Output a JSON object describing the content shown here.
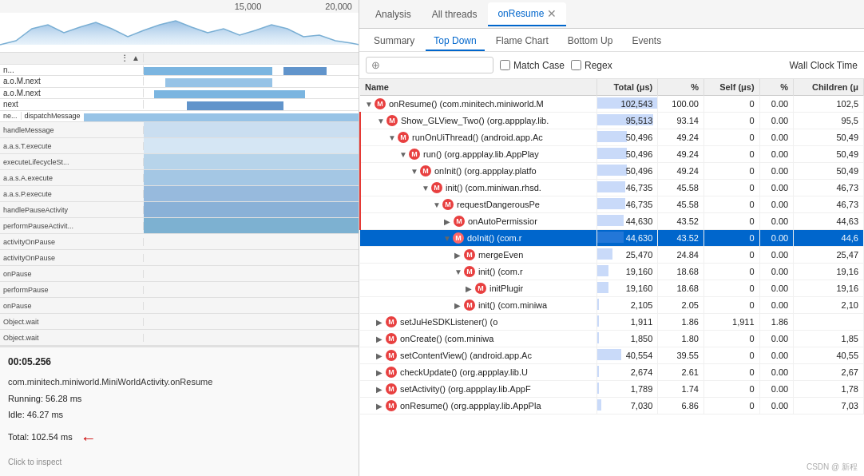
{
  "leftPanel": {
    "timelineNumbers": [
      "15,000",
      "20,000"
    ],
    "infoBox": {
      "time": "00:05.256",
      "className": "com.minitech.miniworld.MiniWorldActivity.onResume",
      "running": "Running: 56.28 ms",
      "idle": "Idle: 46.27 ms",
      "total": "Total: 102.54 ms",
      "clickHint": "Click to inspect"
    }
  },
  "rightPanel": {
    "tabs": [
      {
        "id": "analysis",
        "label": "Analysis",
        "active": false,
        "closeable": false
      },
      {
        "id": "allthreads",
        "label": "All threads",
        "active": false,
        "closeable": false
      },
      {
        "id": "onresume",
        "label": "onResume",
        "active": true,
        "closeable": true
      }
    ],
    "subtabs": [
      {
        "id": "summary",
        "label": "Summary",
        "active": false
      },
      {
        "id": "topdown",
        "label": "Top Down",
        "active": true
      },
      {
        "id": "flamechart",
        "label": "Flame Chart",
        "active": false
      },
      {
        "id": "bottomup",
        "label": "Bottom Up",
        "active": false
      },
      {
        "id": "events",
        "label": "Events",
        "active": false
      }
    ],
    "filter": {
      "searchPlaceholder": "⊕",
      "matchCaseLabel": "Match Case",
      "regexLabel": "Regex",
      "wallClockLabel": "Wall Clock Time"
    },
    "columns": [
      {
        "id": "name",
        "label": "Name"
      },
      {
        "id": "total",
        "label": "Total (μs)",
        "align": "right"
      },
      {
        "id": "pct",
        "label": "%",
        "align": "right"
      },
      {
        "id": "self",
        "label": "Self (μs)",
        "align": "right"
      },
      {
        "id": "selfpct",
        "label": "%",
        "align": "right"
      },
      {
        "id": "children",
        "label": "Children (μ",
        "align": "right"
      }
    ],
    "rows": [
      {
        "id": 1,
        "indent": 0,
        "expanded": true,
        "arrow": "▼",
        "icon": "m",
        "name": "onResume() (com.minitech.miniworld.M",
        "total": "102,543",
        "pct": "100.00",
        "self": "0",
        "selfpct": "0.00",
        "children": "102,5",
        "selected": false,
        "redbox": false
      },
      {
        "id": 2,
        "indent": 1,
        "expanded": true,
        "arrow": "▼",
        "icon": "m",
        "name": "Show_GLView_Two() (org.appplay.lib.",
        "total": "95,513",
        "pct": "93.14",
        "self": "0",
        "selfpct": "0.00",
        "children": "95,5",
        "selected": false,
        "redbox": true
      },
      {
        "id": 3,
        "indent": 2,
        "expanded": true,
        "arrow": "▼",
        "icon": "m",
        "name": "runOnUiThread() (android.app.Ac",
        "total": "50,496",
        "pct": "49.24",
        "self": "0",
        "selfpct": "0.00",
        "children": "50,49",
        "selected": false,
        "redbox": true
      },
      {
        "id": 4,
        "indent": 3,
        "expanded": true,
        "arrow": "▼",
        "icon": "m",
        "name": "run() (org.appplay.lib.AppPlay",
        "total": "50,496",
        "pct": "49.24",
        "self": "0",
        "selfpct": "0.00",
        "children": "50,49",
        "selected": false,
        "redbox": true
      },
      {
        "id": 5,
        "indent": 4,
        "expanded": true,
        "arrow": "▼",
        "icon": "m",
        "name": "onInit() (org.appplay.platfo",
        "total": "50,496",
        "pct": "49.24",
        "self": "0",
        "selfpct": "0.00",
        "children": "50,49",
        "selected": false,
        "redbox": true
      },
      {
        "id": 6,
        "indent": 5,
        "expanded": true,
        "arrow": "▼",
        "icon": "m",
        "name": "init() (com.miniwan.rhsd.",
        "total": "46,735",
        "pct": "45.58",
        "self": "0",
        "selfpct": "0.00",
        "children": "46,73",
        "selected": false,
        "redbox": true
      },
      {
        "id": 7,
        "indent": 6,
        "expanded": true,
        "arrow": "▼",
        "icon": "m",
        "name": "requestDangerousPe",
        "total": "46,735",
        "pct": "45.58",
        "self": "0",
        "selfpct": "0.00",
        "children": "46,73",
        "selected": false,
        "redbox": true
      },
      {
        "id": 8,
        "indent": 7,
        "expanded": false,
        "arrow": "▶",
        "icon": "m",
        "name": "onAutoPermissior",
        "total": "44,630",
        "pct": "43.52",
        "self": "0",
        "selfpct": "0.00",
        "children": "44,63",
        "selected": false,
        "redbox": true
      },
      {
        "id": 9,
        "indent": 7,
        "expanded": true,
        "arrow": "▼",
        "icon": "m",
        "name": "doInit() (com.r",
        "total": "44,630",
        "pct": "43.52",
        "self": "0",
        "selfpct": "0.00",
        "children": "44,6",
        "selected": true,
        "redbox": false
      },
      {
        "id": 10,
        "indent": 8,
        "expanded": false,
        "arrow": "▶",
        "icon": "m",
        "name": "mergeEven",
        "total": "25,470",
        "pct": "24.84",
        "self": "0",
        "selfpct": "0.00",
        "children": "25,47",
        "selected": false,
        "redbox": false
      },
      {
        "id": 11,
        "indent": 8,
        "expanded": true,
        "arrow": "▼",
        "icon": "m",
        "name": "init() (com.r",
        "total": "19,160",
        "pct": "18.68",
        "self": "0",
        "selfpct": "0.00",
        "children": "19,16",
        "selected": false,
        "redbox": false
      },
      {
        "id": 12,
        "indent": 9,
        "expanded": false,
        "arrow": "▶",
        "icon": "m",
        "name": "initPlugir",
        "total": "19,160",
        "pct": "18.68",
        "self": "0",
        "selfpct": "0.00",
        "children": "19,16",
        "selected": false,
        "redbox": false
      },
      {
        "id": 13,
        "indent": 8,
        "expanded": false,
        "arrow": "▶",
        "icon": "m",
        "name": "init() (com.miniwa",
        "total": "2,105",
        "pct": "2.05",
        "self": "0",
        "selfpct": "0.00",
        "children": "2,10",
        "selected": false,
        "redbox": false
      },
      {
        "id": 14,
        "indent": 1,
        "expanded": false,
        "arrow": "▶",
        "icon": "m",
        "name": "setJuHeSDKListener() (o",
        "total": "1,911",
        "pct": "1.86",
        "self": "1,911",
        "selfpct": "1.86",
        "children": "",
        "selected": false,
        "redbox": false
      },
      {
        "id": 15,
        "indent": 1,
        "expanded": false,
        "arrow": "▶",
        "icon": "m",
        "name": "onCreate() (com.miniwa",
        "total": "1,850",
        "pct": "1.80",
        "self": "0",
        "selfpct": "0.00",
        "children": "1,85",
        "selected": false,
        "redbox": false
      },
      {
        "id": 16,
        "indent": 1,
        "expanded": false,
        "arrow": "▶",
        "icon": "m",
        "name": "setContentView() (android.app.Ac",
        "total": "40,554",
        "pct": "39.55",
        "self": "0",
        "selfpct": "0.00",
        "children": "40,55",
        "selected": false,
        "redbox": false
      },
      {
        "id": 17,
        "indent": 1,
        "expanded": false,
        "arrow": "▶",
        "icon": "m",
        "name": "checkUpdate() (org.appplay.lib.U",
        "total": "2,674",
        "pct": "2.61",
        "self": "0",
        "selfpct": "0.00",
        "children": "2,67",
        "selected": false,
        "redbox": false
      },
      {
        "id": 18,
        "indent": 1,
        "expanded": false,
        "arrow": "▶",
        "icon": "m",
        "name": "setActivity() (org.appplay.lib.AppF",
        "total": "1,789",
        "pct": "1.74",
        "self": "0",
        "selfpct": "0.00",
        "children": "1,78",
        "selected": false,
        "redbox": false
      },
      {
        "id": 19,
        "indent": 1,
        "expanded": false,
        "arrow": "▶",
        "icon": "m",
        "name": "onResume() (org.appplay.lib.AppPla",
        "total": "7,030",
        "pct": "6.86",
        "self": "0",
        "selfpct": "0.00",
        "children": "7,03",
        "selected": false,
        "redbox": false
      }
    ]
  },
  "watermark": "CSDN @ 新程"
}
